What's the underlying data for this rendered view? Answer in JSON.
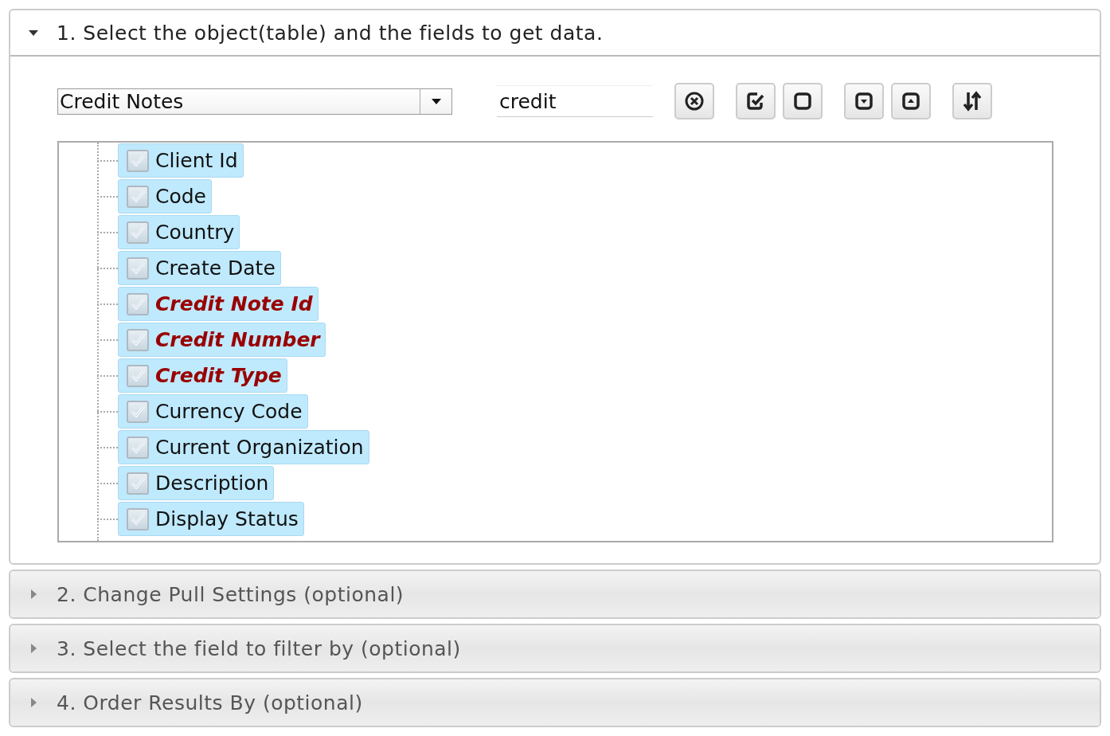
{
  "sections": [
    {
      "title": "1. Select the object(table) and the fields to get data.",
      "expanded": true
    },
    {
      "title": "2. Change Pull Settings (optional)",
      "expanded": false
    },
    {
      "title": "3. Select the field to filter by (optional)",
      "expanded": false
    },
    {
      "title": "4. Order Results By (optional)",
      "expanded": false
    }
  ],
  "object_select": {
    "value": "Credit Notes"
  },
  "search": {
    "value": "credit"
  },
  "fields": [
    {
      "label": "Client Id",
      "checked": true,
      "selected": true,
      "emphasized": false
    },
    {
      "label": "Code",
      "checked": true,
      "selected": true,
      "emphasized": false
    },
    {
      "label": "Country",
      "checked": true,
      "selected": true,
      "emphasized": false
    },
    {
      "label": "Create Date",
      "checked": true,
      "selected": true,
      "emphasized": false
    },
    {
      "label": "Credit Note Id",
      "checked": true,
      "selected": true,
      "emphasized": true
    },
    {
      "label": "Credit Number",
      "checked": true,
      "selected": true,
      "emphasized": true
    },
    {
      "label": "Credit Type",
      "checked": true,
      "selected": true,
      "emphasized": true
    },
    {
      "label": "Currency Code",
      "checked": true,
      "selected": true,
      "emphasized": false
    },
    {
      "label": "Current Organization",
      "checked": true,
      "selected": true,
      "emphasized": false
    },
    {
      "label": "Description",
      "checked": true,
      "selected": true,
      "emphasized": false
    },
    {
      "label": "Display Status",
      "checked": true,
      "selected": true,
      "emphasized": false
    }
  ]
}
